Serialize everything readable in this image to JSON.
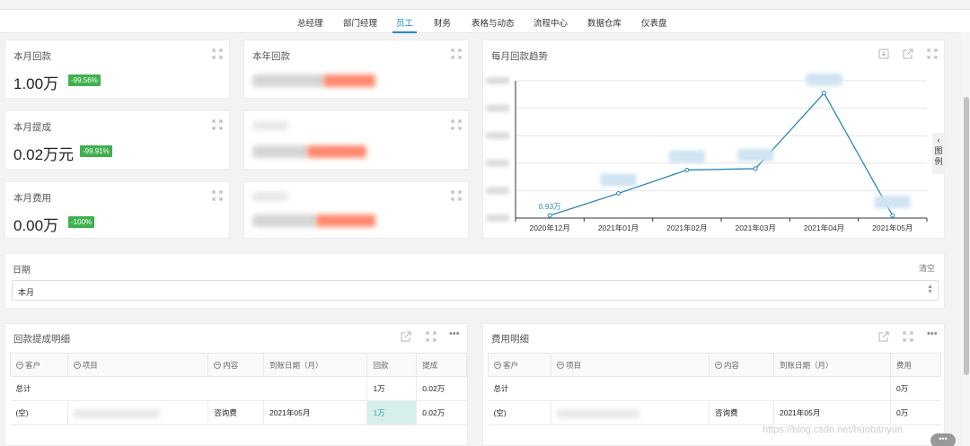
{
  "nav": {
    "tabs": [
      {
        "label": "总经理"
      },
      {
        "label": "部门经理"
      },
      {
        "label": "员工"
      },
      {
        "label": "财务"
      },
      {
        "label": "表格与动态"
      },
      {
        "label": "流程中心"
      },
      {
        "label": "数据仓库"
      },
      {
        "label": "仪表盘"
      }
    ],
    "active": "员工"
  },
  "kpis": [
    {
      "title": "本月回款",
      "value": "1.00万",
      "change": "-99.56%"
    },
    {
      "title": "本月提成",
      "value": "0.02万元",
      "change": "-99.91%"
    },
    {
      "title": "本月费用",
      "value": "0.00万",
      "change": "-100%"
    }
  ],
  "kpis_right": [
    {
      "title": "本年回款"
    }
  ],
  "chart": {
    "title": "每月回款趋势",
    "legend_toggle": "图例",
    "colors": {
      "line": "#2b88b8",
      "grid": "#e6e6e6",
      "axis": "#333333"
    }
  },
  "chart_data": {
    "type": "line",
    "categories": [
      "2020年12月",
      "2021年01月",
      "2021年02月",
      "2021年03月",
      "2021年04月",
      "2021年05月"
    ],
    "series": [
      {
        "values": [
          0.93,
          9.0,
          17.5,
          18.0,
          45.5,
          0.93
        ]
      }
    ],
    "data_labels": [
      "0.93万",
      "",
      "",
      "",
      "",
      ""
    ],
    "xlabel": "",
    "ylabel": "",
    "ylim": [
      0,
      50
    ],
    "grid": true,
    "legend": "right (collapsed)"
  },
  "filter": {
    "label": "日期",
    "clear": "清空",
    "value": "本月"
  },
  "table_left": {
    "title": "回款提成明细",
    "headers": [
      "客户",
      "项目",
      "内容",
      "到账日期（月）",
      "回款",
      "提成"
    ],
    "collapsible": [
      true,
      true,
      true,
      false,
      false,
      false
    ],
    "total_label": "总计",
    "total_values": [
      "",
      "",
      "",
      "",
      "1万",
      "0.02万"
    ],
    "rows": [
      [
        "(空)",
        "",
        "咨询费",
        "2021年05月",
        "1万",
        "0.02万"
      ]
    ]
  },
  "table_right": {
    "title": "费用明细",
    "headers": [
      "客户",
      "项目",
      "内容",
      "到账日期（月）",
      "费用"
    ],
    "collapsible": [
      true,
      true,
      true,
      false,
      false
    ],
    "total_label": "总计",
    "total_values": [
      "",
      "",
      "",
      "",
      "0万"
    ],
    "rows": [
      [
        "(空)",
        "",
        "咨询费",
        "2021年05月",
        "0万"
      ]
    ]
  },
  "watermark": "https://blog.csdn.net/huobanyun",
  "more_button": "•••"
}
